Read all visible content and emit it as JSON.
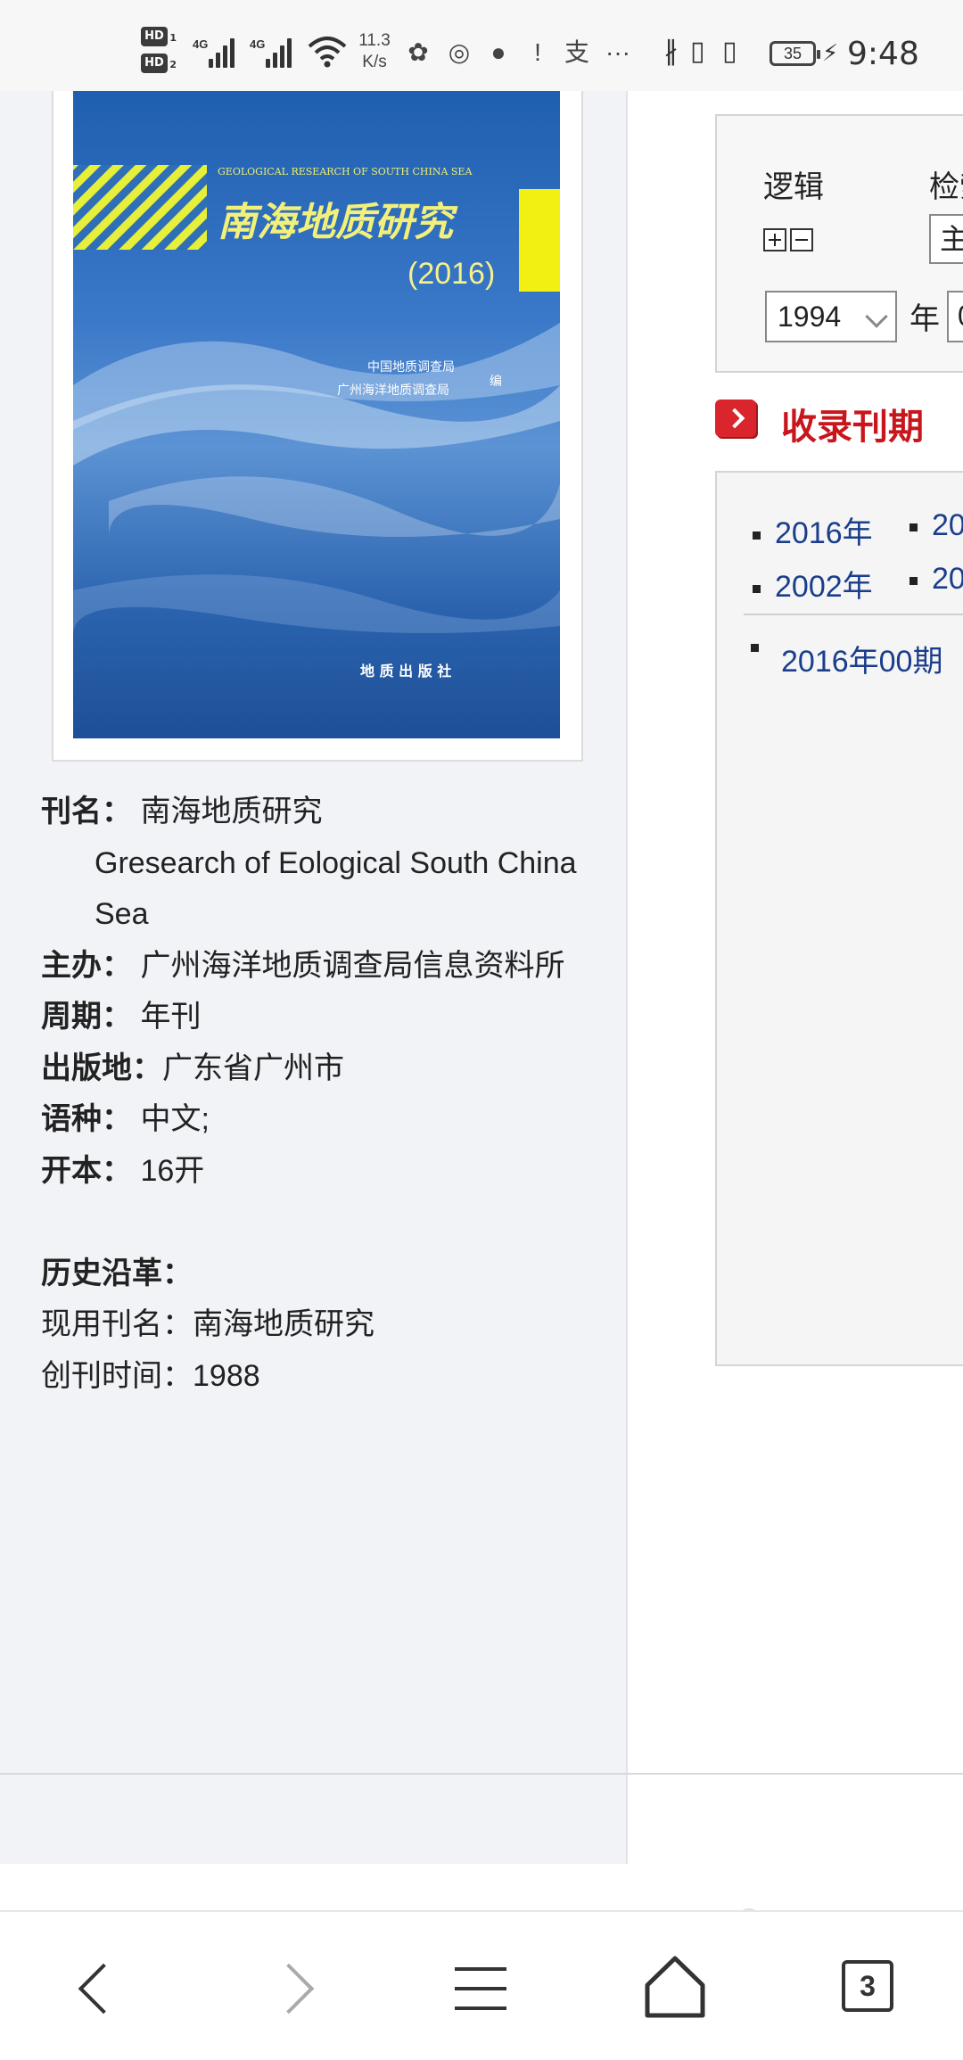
{
  "status_bar": {
    "network_speed_value": "11.3",
    "network_speed_unit": "K/s",
    "hd_label": "HD",
    "sim1": "1",
    "sim2": "2",
    "signal_label": "4G",
    "battery_level": "35",
    "time": "9:48",
    "more_indicator": "···",
    "notification_icons": [
      "hedgehog-app-icon",
      "qq-icon",
      "wechat-icon",
      "alert-icon",
      "alipay-icon"
    ],
    "right_icons": [
      "bluetooth-icon",
      "battery-saver-icon",
      "vibrate-icon"
    ]
  },
  "journal_cover": {
    "english_title": "GEOLOGICAL RESEARCH OF SOUTH CHINA SEA",
    "chinese_title": "南海地质研究",
    "year": "(2016)",
    "editor_line1": "中国地质调查局",
    "editor_line2": "广州海洋地质调查局",
    "editor_suffix": "编",
    "publisher": "地 质 出 版 社"
  },
  "journal_info": {
    "name_label": "刊名：",
    "name_value": "南海地质研究",
    "english_name": "Gresearch of Eological South China Sea",
    "sponsor_label": "主办：",
    "sponsor_value": "广州海洋地质调查局信息资料所",
    "cycle_label": "周期：",
    "cycle_value": "年刊",
    "place_label": "出版地：",
    "place_value": "广东省广州市",
    "language_label": "语种：",
    "language_value": "中文;",
    "format_label": "开本：",
    "format_value": "16开",
    "history_label": "历史沿革：",
    "current_name_line": "现用刊名：南海地质研究",
    "founded_line": "创刊时间：1988"
  },
  "search_panel": {
    "logic_label": "逻辑",
    "field_label": "检索",
    "field_value": "主",
    "year_value": "1994",
    "year_unit": "年",
    "period_value": "0"
  },
  "issues_section": {
    "title": "收录刊期",
    "years": [
      "2016年",
      "20",
      "2002年",
      "20"
    ],
    "issue_item": "2016年00期"
  },
  "bottom_nav": {
    "tab_count": "3"
  },
  "colors": {
    "accent_red": "#c8161d",
    "link_blue": "#1a3e8c",
    "panel_bg": "#f1f3f7"
  }
}
